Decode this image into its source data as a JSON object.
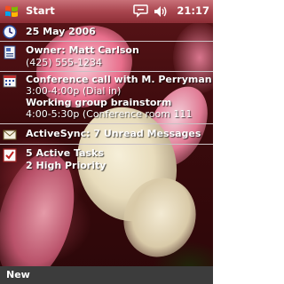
{
  "taskbar": {
    "start_label": "Start",
    "time": "21:17"
  },
  "today": {
    "date": "25 May 2006",
    "owner_line": "Owner: Matt Carlson",
    "owner_phone": "(425) 555-1234",
    "calendar": [
      {
        "title": "Conference call with M. Perryman",
        "detail": "3:00-4:00p (Dial in)"
      },
      {
        "title": "Working group brainstorm",
        "detail": "4:00-5:30p (Conference room 111"
      }
    ],
    "messaging": "ActiveSync: 7 Unread Messages",
    "tasks_line1": "5 Active Tasks",
    "tasks_line2": "2 High Priority"
  },
  "softkeys": {
    "left": "New"
  },
  "colors": {
    "titlebar": "#a8454e",
    "softkey_bar": "#3c3c3c",
    "text": "#ffffff"
  }
}
